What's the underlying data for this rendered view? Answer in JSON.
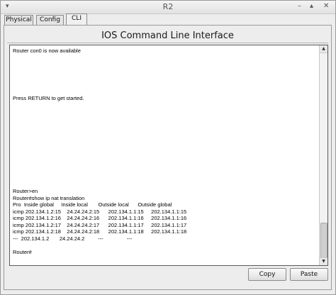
{
  "window": {
    "title": "R2",
    "menu_icon": "▾",
    "min_icon": "–",
    "max_icon": "▴",
    "close_icon": "✕"
  },
  "tabs": [
    {
      "label": "Physical"
    },
    {
      "label": "Config"
    },
    {
      "label": "CLI"
    }
  ],
  "panel": {
    "title": "IOS Command Line Interface"
  },
  "console": {
    "lines": [
      "Router con0 is now available",
      "Press RETURN to get started.",
      "Router>en",
      "Router#show ip nat translation",
      "Pro  Inside global     Inside local       Outside local      Outside global",
      "icmp 202.134.1.2:15    24.24.24.2:15      202.134.1.1:15     202.134.1.1:15",
      "icmp 202.134.1.2:16    24.24.24.2:16      202.134.1.1:16     202.134.1.1:16",
      "icmp 202.134.1.2:17    24.24.24.2:17      202.134.1.1:17     202.134.1.1:17",
      "icmp 202.134.1.2:18    24.24.24.2:18      202.134.1.1:18     202.134.1.1:18",
      "---  202.134.1.2       24.24.24.2         ---                ---",
      "Router#"
    ]
  },
  "buttons": {
    "copy": "Copy",
    "paste": "Paste"
  }
}
